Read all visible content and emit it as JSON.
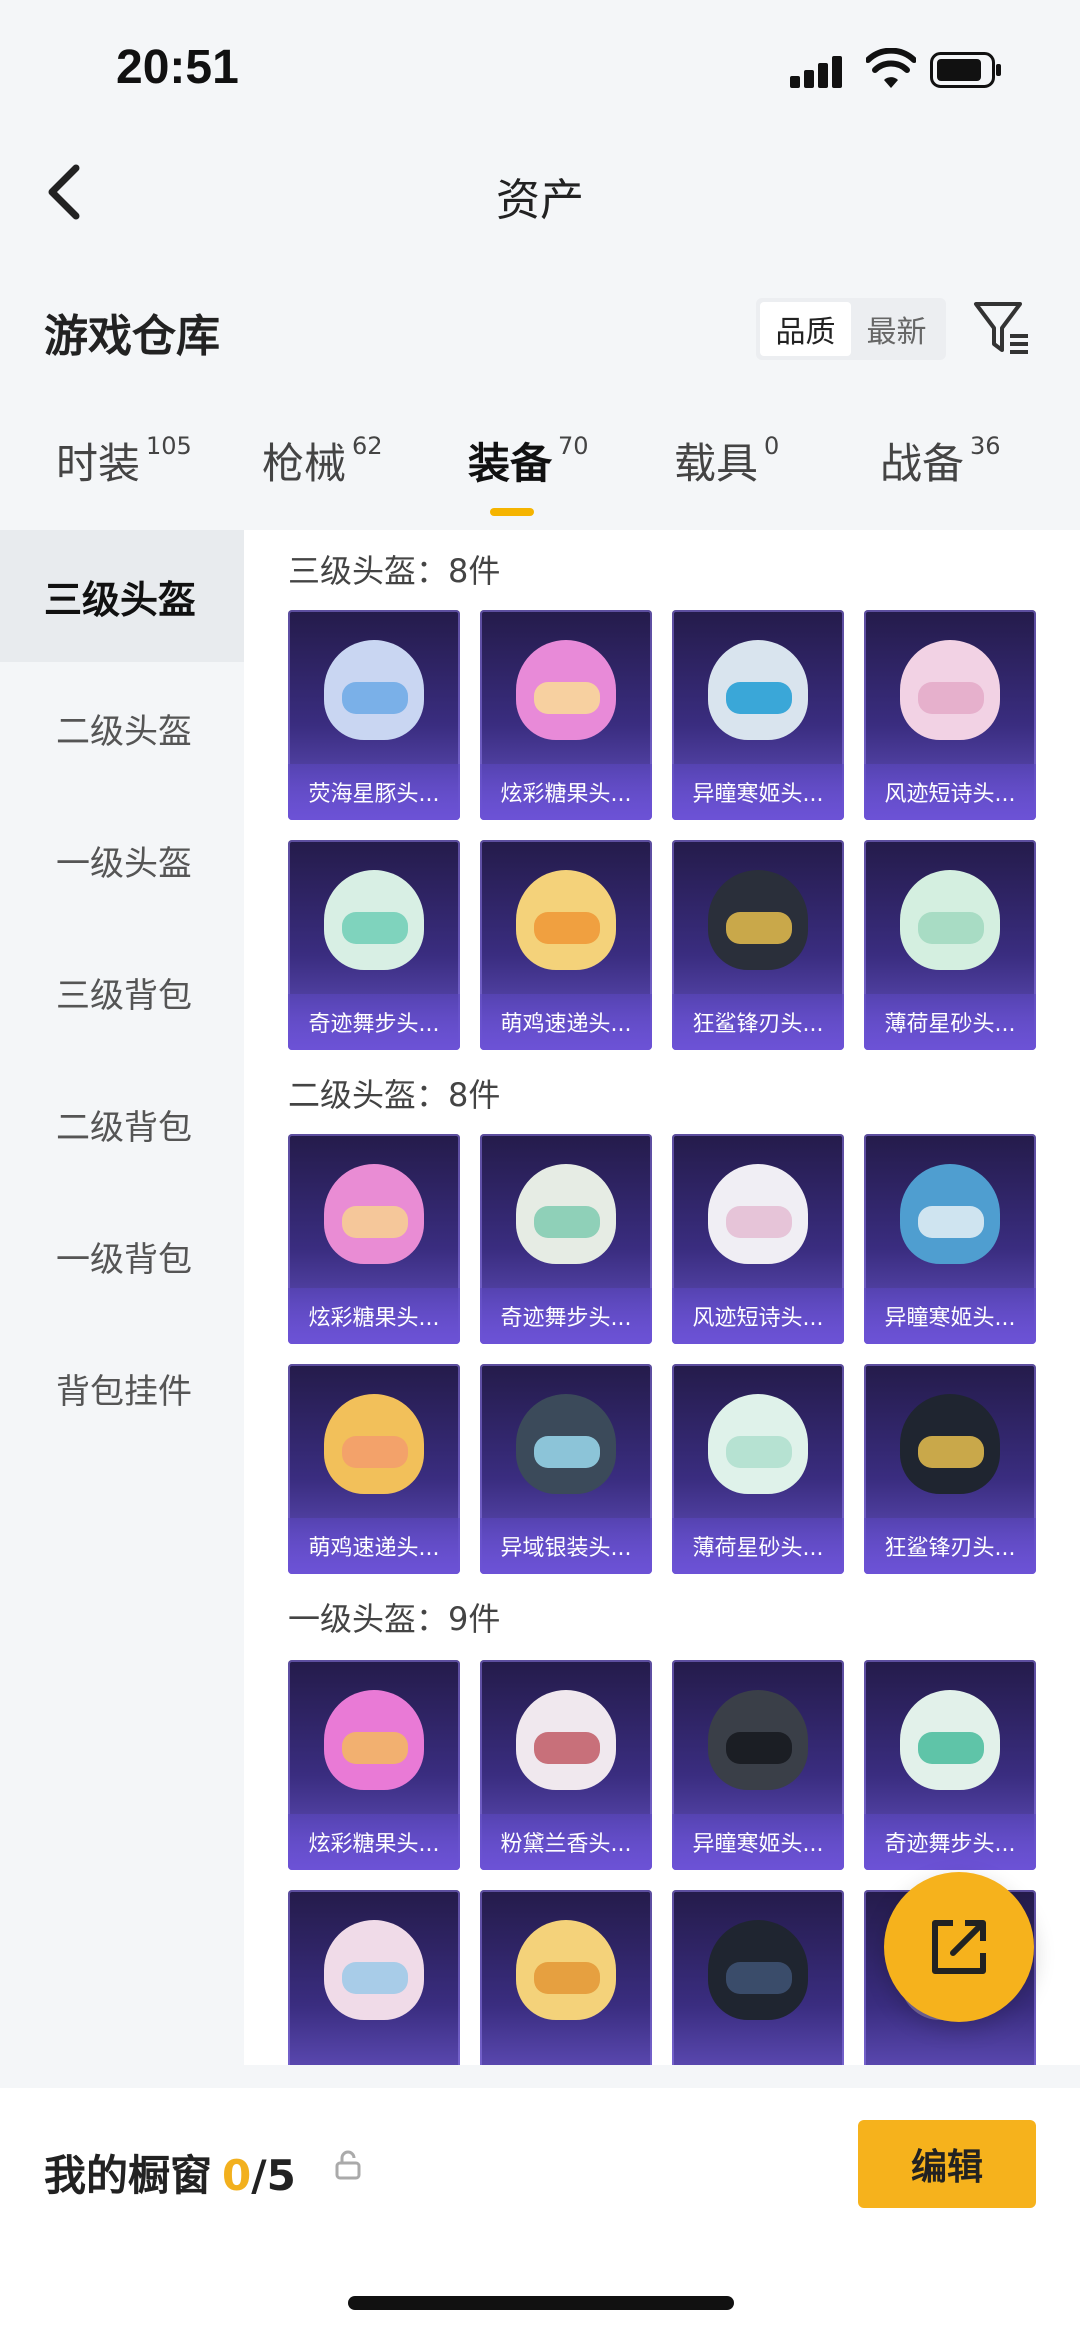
{
  "status": {
    "time": "20:51"
  },
  "nav": {
    "title": "资产"
  },
  "warehouse": {
    "title": "游戏仓库",
    "sort": [
      "品质",
      "最新"
    ],
    "active_sort": "品质"
  },
  "tabs": [
    {
      "label": "时装",
      "count": "105"
    },
    {
      "label": "枪械",
      "count": "62"
    },
    {
      "label": "装备",
      "count": "70"
    },
    {
      "label": "载具",
      "count": "0"
    },
    {
      "label": "战备",
      "count": "36"
    }
  ],
  "sidebar": [
    {
      "label": "三级头盔"
    },
    {
      "label": "二级头盔"
    },
    {
      "label": "一级头盔"
    },
    {
      "label": "三级背包"
    },
    {
      "label": "二级背包"
    },
    {
      "label": "一级背包"
    },
    {
      "label": "背包挂件"
    }
  ],
  "sections": [
    {
      "title": "三级头盔：8件",
      "items": [
        "荧海星豚头...",
        "炫彩糖果头...",
        "异瞳寒姬头...",
        "风迹短诗头...",
        "奇迹舞步头...",
        "萌鸡速递头...",
        "狂鲨锋刃头...",
        "薄荷星砂头..."
      ]
    },
    {
      "title": "二级头盔：8件",
      "items": [
        "炫彩糖果头...",
        "奇迹舞步头...",
        "风迹短诗头...",
        "异瞳寒姬头...",
        "萌鸡速递头...",
        "异域银装头...",
        "薄荷星砂头...",
        "狂鲨锋刃头..."
      ]
    },
    {
      "title": "一级头盔：9件",
      "items": [
        "炫彩糖果头...",
        "粉黛兰香头...",
        "异瞳寒姬头...",
        "奇迹舞步头..."
      ]
    }
  ],
  "bottom": {
    "label": "我的橱窗",
    "count": "0",
    "total": "/5",
    "edit_label": "编辑"
  },
  "colors": {
    "accent": "#f6b21c",
    "card_top": "#241b4a",
    "card_bottom": "#6a56c8"
  }
}
